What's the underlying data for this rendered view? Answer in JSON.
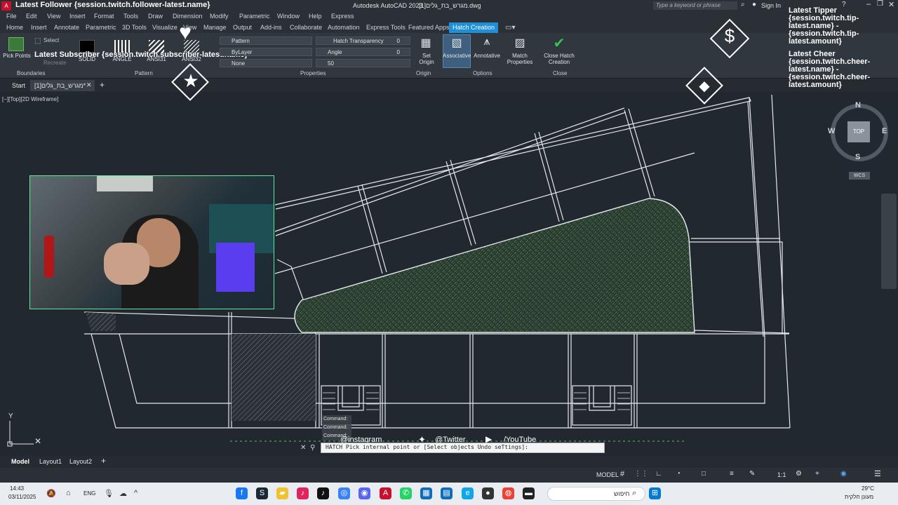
{
  "titlebar": {
    "app_title": "Autodesk AutoCAD 2023",
    "file_title": "מגרש_בת_גלים[1].dwg",
    "search_placeholder": "Type a keyword or phrase",
    "sign_in": "Sign In",
    "overlay_follower": "Latest Follower {session.twitch.follower-latest.name}"
  },
  "menu": [
    "File",
    "Edit",
    "View",
    "Insert",
    "Format",
    "Tools",
    "Draw",
    "Dimension",
    "Modify",
    "Parametric",
    "Window",
    "Help",
    "Express"
  ],
  "ribbon_tabs": [
    "Home",
    "Insert",
    "Annotate",
    "Parametric",
    "3D Tools",
    "Visualize",
    "View",
    "Manage",
    "Output",
    "Add-ins",
    "Collaborate",
    "Automation",
    "Express Tools",
    "Featured Apps",
    "Hatch Creation"
  ],
  "ribbon": {
    "pick_points": "Pick Points",
    "select": "Select",
    "recreate": "Recreate",
    "patterns": [
      "SOLID",
      "ANGLE",
      "ANSI31",
      "ANSI32"
    ],
    "pattern_combo": "Pattern",
    "color_combo": "ByLayer",
    "none_combo": "None",
    "hatch_transparency_label": "Hatch Transparency",
    "hatch_transparency_value": "0",
    "angle_label": "Angle",
    "angle_value": "0",
    "scale_value": "50",
    "set_origin": "Set Origin",
    "associative": "Associative",
    "annotative": "Annotative",
    "match_properties": "Match Properties",
    "close_hatch_creation": "Close Hatch Creation",
    "panels": [
      "Boundaries",
      "Pattern",
      "Properties",
      "Origin",
      "Options",
      "Close"
    ],
    "overlay_subscriber": "Latest Subscriber {session.twitch.subscriber-latest.name}"
  },
  "filetabs": {
    "start": "Start",
    "file_tab": "מגרש_בת_גלים[1]*"
  },
  "viewport": {
    "view_label": "[−][Top][2D Wireframe]",
    "compass": {
      "n": "N",
      "s": "S",
      "e": "E",
      "w": "W",
      "top": "TOP",
      "wcs": "WCS"
    },
    "ucs_y": "Y",
    "commands": [
      "Command:",
      "Command:",
      "Command:"
    ],
    "command_prompt": "HATCH Pick internal point or [Select objects Undo seTtings]:",
    "social": [
      "@instagram",
      "@Twitter",
      "/YouTube"
    ]
  },
  "overlay_right": {
    "tipper": "Latest Tipper {session.twitch.tip-latest.name} - {session.twitch.tip-latest.amount}",
    "cheer": "Latest Cheer {session.twitch.cheer-latest.name} - {session.twitch.cheer-latest.amount}"
  },
  "layout_tabs": [
    "Model",
    "Layout1",
    "Layout2"
  ],
  "status": {
    "model": "MODEL",
    "scale": "1:1"
  },
  "taskbar": {
    "time": "14:43",
    "date": "03/11/2025",
    "lang": "ENG",
    "search": "חיפוש",
    "weather": "29°C",
    "weather_text": "מעונן חלקית"
  }
}
